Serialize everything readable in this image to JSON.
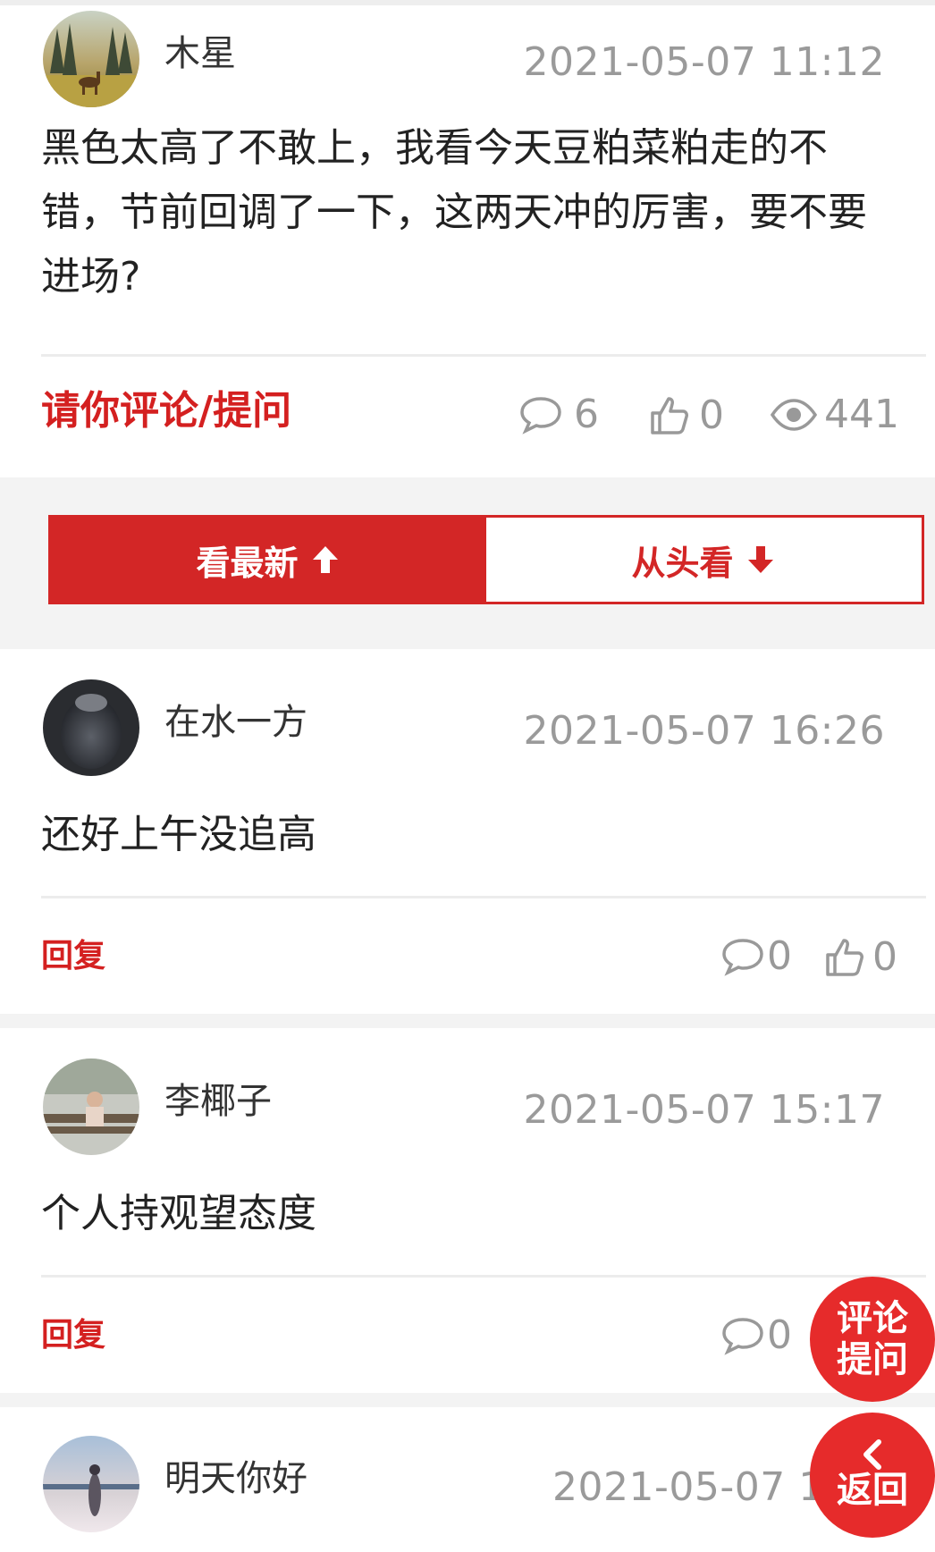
{
  "post": {
    "author": "木星",
    "time": "2021-05-07 11:12",
    "content": "黑色太高了不敢上，我看今天豆粕菜粕走的不错，节前回调了一下，这两天冲的厉害，要不要进场?",
    "comment_prompt": "请你评论/提问",
    "comments": "6",
    "likes": "0",
    "views": "441"
  },
  "sort": {
    "latest_label": "看最新",
    "from_start_label": "从头看"
  },
  "comments": [
    {
      "author": "在水一方",
      "time": "2021-05-07 16:26",
      "text": "还好上午没追高",
      "reply_label": "回复",
      "replies": "0",
      "likes": "0"
    },
    {
      "author": "李椰子",
      "time": "2021-05-07 15:17",
      "text": "个人持观望态度",
      "reply_label": "回复",
      "replies": "0",
      "likes": ""
    },
    {
      "author": "明天你好",
      "time": "2021-05-07 15:",
      "text": ""
    }
  ],
  "fab": {
    "comment_line1": "评论",
    "comment_line2": "提问",
    "back_label": "返回"
  },
  "colors": {
    "accent": "#d32626",
    "fab": "#e62b2b",
    "muted": "#999999"
  },
  "icons": [
    "comment-icon",
    "thumbs-up-icon",
    "eye-icon",
    "arrow-up-icon",
    "arrow-down-icon",
    "chevron-left-icon"
  ]
}
